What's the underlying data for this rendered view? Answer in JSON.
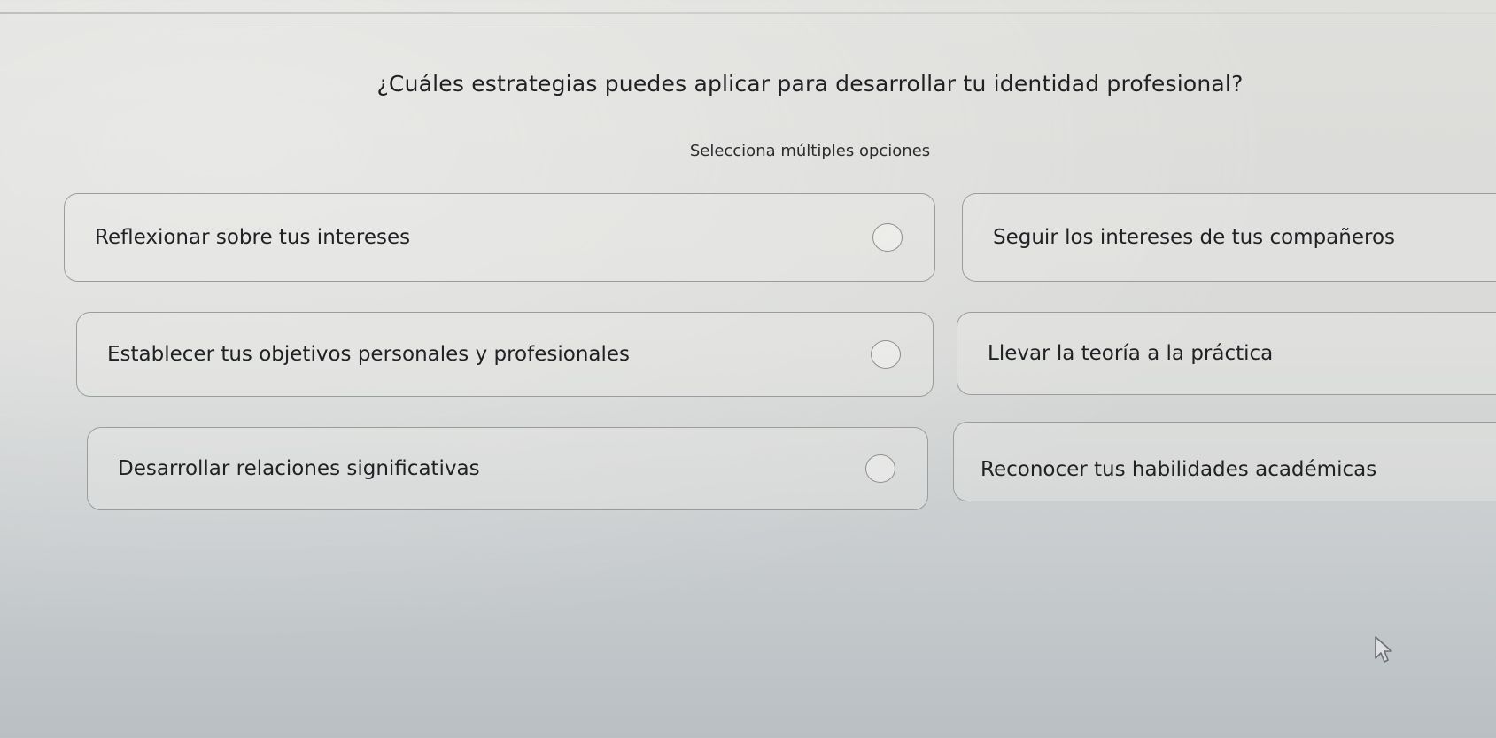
{
  "quiz": {
    "question": "¿Cuáles estrategias puedes aplicar para desarrollar tu identidad profesional?",
    "instruction": "Selecciona múltiples opciones",
    "options": [
      {
        "label": "Reflexionar sobre tus intereses",
        "has_radio": true
      },
      {
        "label": "Seguir los intereses de tus compañeros",
        "has_radio": false
      },
      {
        "label": "Establecer tus objetivos personales y profesionales",
        "has_radio": true
      },
      {
        "label": "Llevar la teoría a la práctica",
        "has_radio": false
      },
      {
        "label": "Desarrollar relaciones significativas",
        "has_radio": true
      },
      {
        "label": "Reconocer tus habilidades académicas",
        "has_radio": false
      }
    ]
  },
  "icons": {
    "option_selector": "radio-circle-icon",
    "pointer": "mouse-cursor-icon"
  },
  "colors": {
    "text": "#1f2124",
    "border": "#9a9c9e",
    "background": "#d9dad8"
  }
}
